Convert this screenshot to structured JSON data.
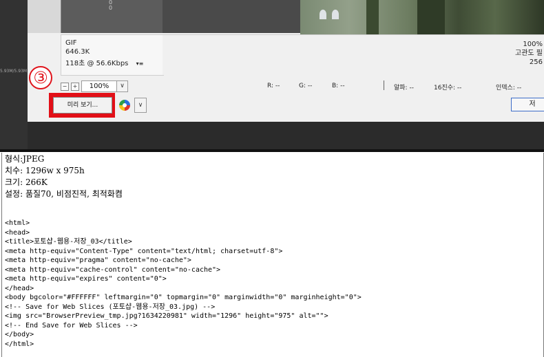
{
  "preview_panel": {
    "format": "GIF",
    "size": "646.3K",
    "time": "118초 @ 56.6Kbps",
    "time_menu_icon": "menu-lines-icon",
    "preview_digits": [
      "0",
      "0"
    ],
    "right_percent": "100%",
    "right_label": "고관도 필",
    "right_number": "256"
  },
  "left_strip": {
    "text": "5.93M/5.93M"
  },
  "annotation": {
    "step": "③",
    "color": "#e0141c"
  },
  "status_bar": {
    "zoom_minus": "−",
    "zoom_plus": "+",
    "zoom_value": "100%",
    "r": "R: --",
    "g": "G: --",
    "b": "B: --",
    "alpha": "알파: --",
    "hex": "16진수: --",
    "index": "인덱스: --"
  },
  "buttons": {
    "preview": "미리 보기...",
    "right_button": "저"
  },
  "browser_output": {
    "info_lines": [
      "형식:JPEG",
      "치수: 1296w x 975h",
      "크기: 266K",
      "설정: 품질70, 비점진적, 최적화켬"
    ],
    "code_lines": [
      "<html>",
      "<head>",
      "<title>포토샵-웹용-저장_03</title>",
      "<meta http-equiv=\"Content-Type\" content=\"text/html; charset=utf-8\">",
      "<meta http-equiv=\"pragma\" content=\"no-cache\">",
      "<meta http-equiv=\"cache-control\" content=\"no-cache\">",
      "<meta http-equiv=\"expires\" content=\"0\">",
      "</head>",
      "<body bgcolor=\"#FFFFFF\" leftmargin=\"0\" topmargin=\"0\" marginwidth=\"0\" marginheight=\"0\">",
      "<!-- Save for Web Slices (포토샵-웹용-저장_03.jpg) -->",
      "<img src=\"BrowserPreview_tmp.jpg?1634220981\" width=\"1296\" height=\"975\" alt=\"\">",
      "<!-- End Save for Web Slices -->",
      "</body>",
      "</html>"
    ]
  }
}
